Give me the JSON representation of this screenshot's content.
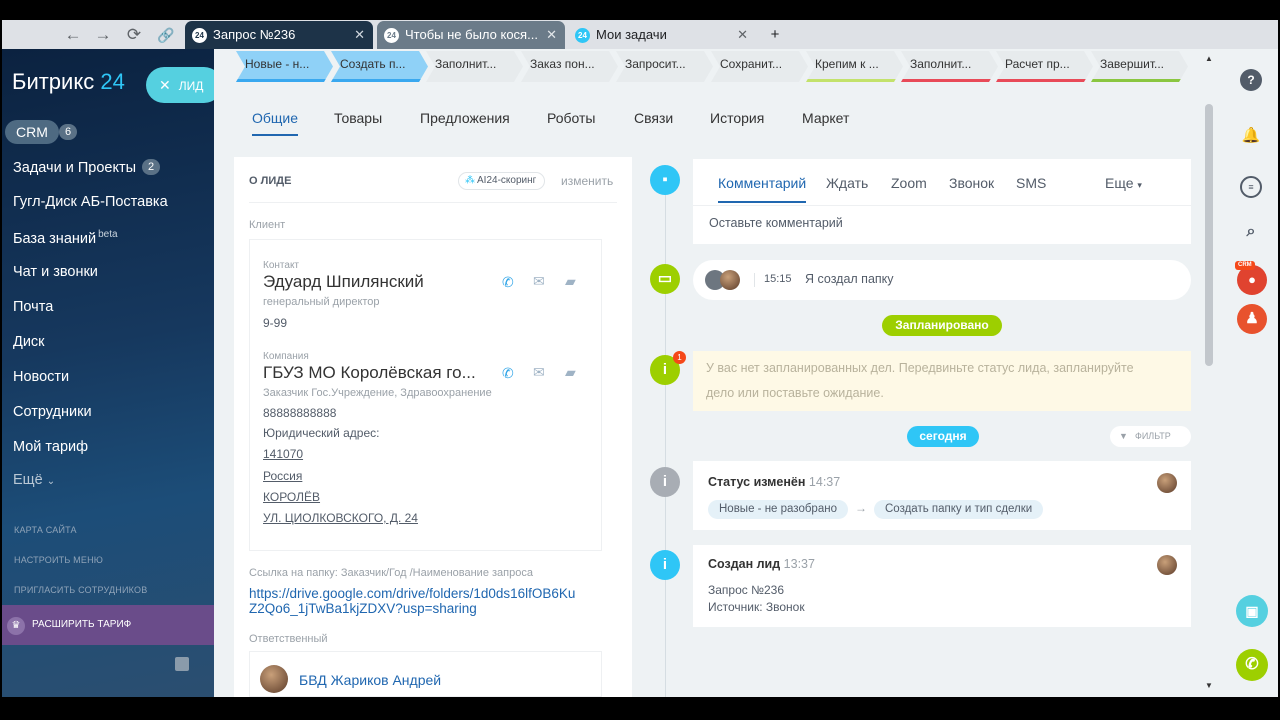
{
  "browser": {
    "tabs": [
      {
        "icon": "24",
        "title": "Запрос №236"
      },
      {
        "icon": "24",
        "title": "Чтобы не было кося..."
      },
      {
        "icon": "24",
        "title": "Мои задачи"
      }
    ],
    "new_tab": "+"
  },
  "sidebar": {
    "logo_text": "Битрикс",
    "logo_num": "24",
    "lead_button": "ЛИД",
    "crm_label": "CRM",
    "crm_count": "6",
    "items": [
      {
        "label": "Задачи и Проекты",
        "count": "2"
      },
      {
        "label": "Гугл-Диск АБ-Поставка"
      },
      {
        "label": "База знаний",
        "sup": "beta"
      },
      {
        "label": "Чат и звонки"
      },
      {
        "label": "Почта"
      },
      {
        "label": "Диск"
      },
      {
        "label": "Новости"
      },
      {
        "label": "Сотрудники"
      },
      {
        "label": "Мой тариф"
      },
      {
        "label": "Ещё"
      }
    ],
    "links": [
      "КАРТА САЙТА",
      "НАСТРОИТЬ МЕНЮ",
      "ПРИГЛАСИТЬ СОТРУДНИКОВ"
    ],
    "upgrade": "РАСШИРИТЬ ТАРИФ"
  },
  "stages": [
    {
      "label": "Новые - н...",
      "color": "#39a8ef"
    },
    {
      "label": "Создать п...",
      "color": "#39a8ef"
    },
    {
      "label": "Заполнит...",
      "color": "#e7ebed"
    },
    {
      "label": "Заказ пон...",
      "color": "#e7ebed"
    },
    {
      "label": "Запросит...",
      "color": "#e7ebed"
    },
    {
      "label": "Сохранит...",
      "color": "#e7ebed"
    },
    {
      "label": "Крепим к ...",
      "color": "#c3e26b"
    },
    {
      "label": "Заполнит...",
      "color": "#e84a58"
    },
    {
      "label": "Расчет пр...",
      "color": "#e84a58"
    },
    {
      "label": "Завершит...",
      "color": "#8ac640"
    }
  ],
  "content_tabs": [
    "Общие",
    "Товары",
    "Предложения",
    "Роботы",
    "Связи",
    "История",
    "Маркет"
  ],
  "lead": {
    "section_title": "О ЛИДЕ",
    "scoring": "AI24-скоринг",
    "change": "изменить",
    "client_label": "Клиент",
    "contact_label": "Контакт",
    "contact_name": "Эдуард Шпилянский",
    "contact_post": "генеральный директор",
    "contact_phone": "9-99",
    "company_label": "Компания",
    "company_name": "ГБУЗ МО Королёвская го...",
    "company_type": "Заказчик Гос.Учреждение, Здравоохранение",
    "company_phone": "88888888888",
    "address_label": "Юридический адрес:",
    "address": [
      "141070",
      "Россия",
      "КОРОЛЁВ",
      "УЛ. ЦИОЛКОВСКОГО, Д. 24"
    ],
    "link_label": "Ссылка на папку: Заказчик/Год /Наименование запроса",
    "link_url_1": "https://drive.google.com/drive/folders/1d0ds16lfOB6Ku",
    "link_url_2": "Z2Qo6_1jTwBa1kjZDXV?usp=sharing",
    "responsible_label": "Ответственный",
    "responsible": "БВД Жариков Андрей"
  },
  "activity": {
    "tabs": [
      "Комментарий",
      "Ждать",
      "Zoom",
      "Звонок",
      "SMS"
    ],
    "more": "Еще",
    "comment_placeholder": "Оставьте комментарий",
    "folder_time": "15:15",
    "folder_text": "Я создал папку",
    "planned_pill": "Запланировано",
    "planned_badge": "1",
    "planned_text_1": "У вас нет запланированных дел. Передвиньте статус лида, запланируйте",
    "planned_text_2": "дело или поставьте ожидание.",
    "today_pill": "сегодня",
    "filter": "ФИЛЬТР",
    "status_title": "Статус изменён",
    "status_time": "14:37",
    "status_from": "Новые - не разобрано",
    "status_arrow": "→",
    "status_to": "Создать папку и тип сделки",
    "created_title": "Создан лид",
    "created_time": "13:37",
    "created_line1": "Запрос №236",
    "created_line2": "Источник: Звонок"
  },
  "right": {
    "help": "?",
    "crm_badge": "CRM"
  }
}
